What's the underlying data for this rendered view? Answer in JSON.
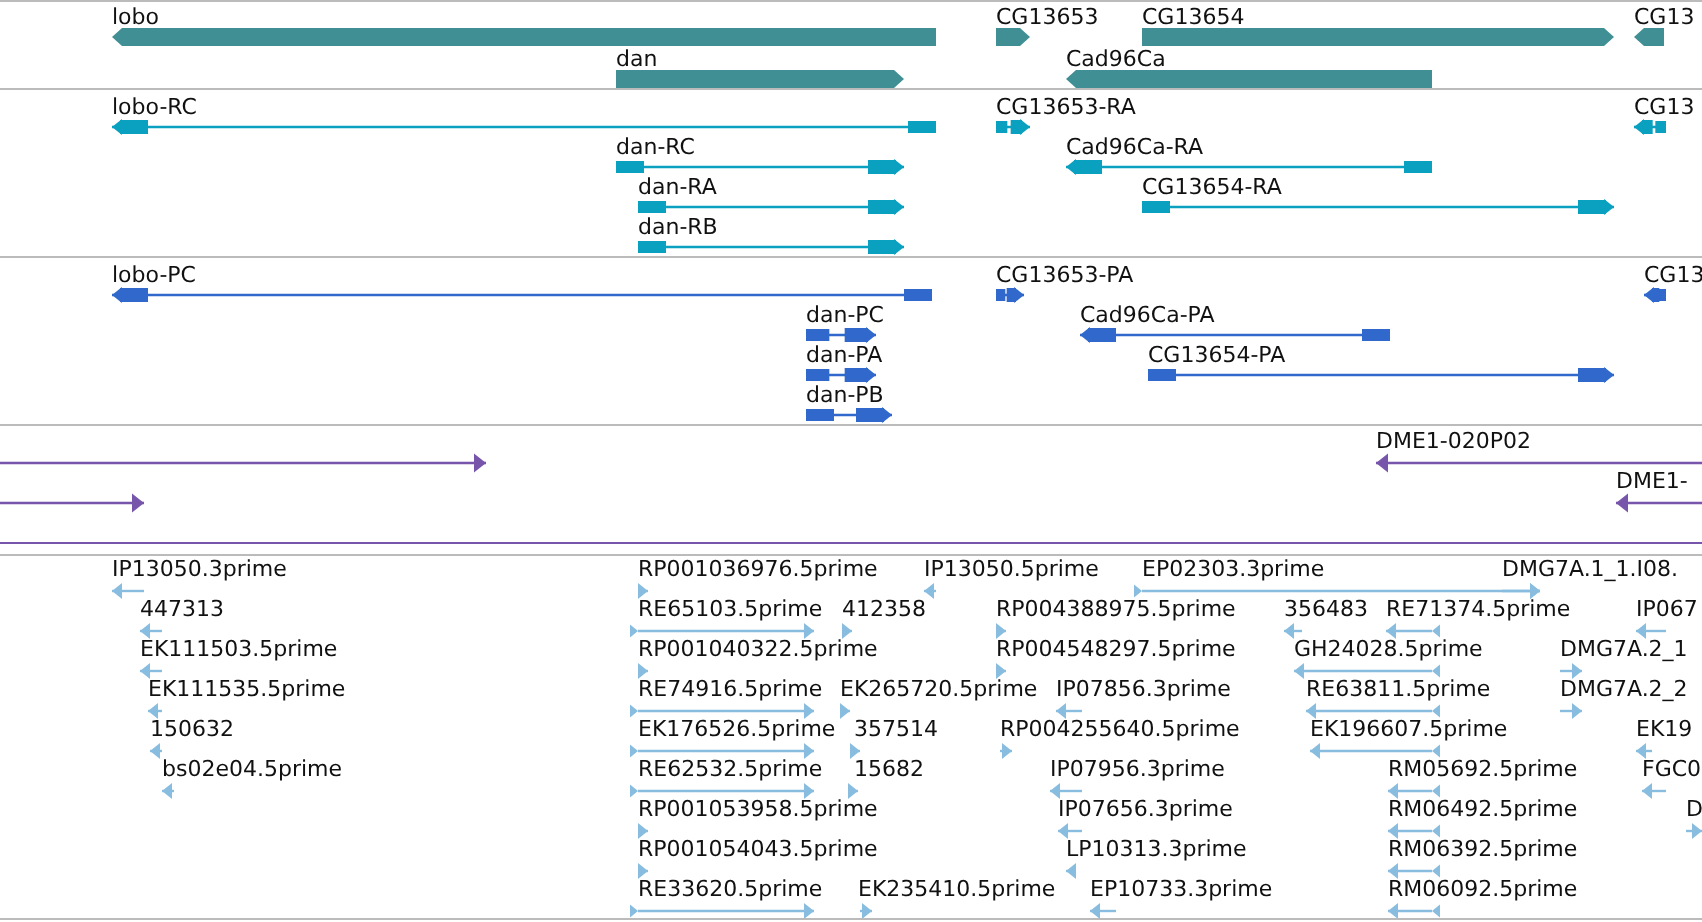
{
  "tracks": [
    {
      "kind": "gene",
      "color": "#3f8f94",
      "features": [
        {
          "label": "lobo",
          "reverse": true
        },
        {
          "label": "CG13653",
          "reverse": false
        },
        {
          "label": "CG13654",
          "reverse": false
        },
        {
          "label": "CG13",
          "reverse": true
        },
        {
          "label": "dan",
          "reverse": false
        },
        {
          "label": "Cad96Ca",
          "reverse": true
        }
      ]
    },
    {
      "kind": "transcript",
      "color": "#0aa0c0",
      "features": [
        {
          "label": "lobo-RC",
          "reverse": true
        },
        {
          "label": "CG13653-RA",
          "reverse": false
        },
        {
          "label": "CG13",
          "reverse": true
        },
        {
          "label": "dan-RC",
          "reverse": false
        },
        {
          "label": "Cad96Ca-RA",
          "reverse": true
        },
        {
          "label": "dan-RA",
          "reverse": false
        },
        {
          "label": "CG13654-RA",
          "reverse": false
        },
        {
          "label": "dan-RB",
          "reverse": false
        }
      ]
    },
    {
      "kind": "transcript",
      "color": "#3068cc",
      "features": [
        {
          "label": "lobo-PC",
          "reverse": true
        },
        {
          "label": "CG13653-PA",
          "reverse": false
        },
        {
          "label": "CG13",
          "reverse": true
        },
        {
          "label": "dan-PC",
          "reverse": false
        },
        {
          "label": "Cad96Ca-PA",
          "reverse": true
        },
        {
          "label": "dan-PA",
          "reverse": false
        },
        {
          "label": "CG13654-PA",
          "reverse": false
        },
        {
          "label": "dan-PB",
          "reverse": false
        }
      ]
    },
    {
      "kind": "clone",
      "color": "#7755aa",
      "features": [
        {
          "reverse": false
        },
        {
          "label": "DME1-020P02",
          "reverse": true
        },
        {
          "reverse": false
        },
        {
          "label": "DME1-",
          "reverse": true
        }
      ]
    },
    {
      "kind": "est",
      "color": "#88bde0",
      "features": [
        {
          "label": "IP13050.3prime",
          "reverse": true
        },
        {
          "label": "RP001036976.5prime",
          "reverse": false
        },
        {
          "label": "IP13050.5prime",
          "reverse": true
        },
        {
          "label": "EP02303.3prime",
          "reverse": false
        },
        {
          "label": "DMG7A.1_1.I08.",
          "reverse": false
        },
        {
          "label": "447313",
          "reverse": true
        },
        {
          "label": "RE65103.5prime",
          "reverse": false
        },
        {
          "label": "412358",
          "reverse": false
        },
        {
          "label": "RP004388975.5prime",
          "reverse": false
        },
        {
          "label": "356483",
          "reverse": true
        },
        {
          "label": "RE71374.5prime",
          "reverse": true
        },
        {
          "label": "IP067",
          "reverse": true
        },
        {
          "label": "EK111503.5prime",
          "reverse": true
        },
        {
          "label": "RP001040322.5prime",
          "reverse": false
        },
        {
          "label": "RP004548297.5prime",
          "reverse": false
        },
        {
          "label": "GH24028.5prime",
          "reverse": true
        },
        {
          "label": "DMG7A.2_1",
          "reverse": false
        },
        {
          "label": "EK111535.5prime",
          "reverse": true
        },
        {
          "label": "RE74916.5prime",
          "reverse": false
        },
        {
          "label": "EK265720.5prime",
          "reverse": false
        },
        {
          "label": "IP07856.3prime",
          "reverse": true
        },
        {
          "label": "RE63811.5prime",
          "reverse": true
        },
        {
          "label": "DMG7A.2_2",
          "reverse": false
        },
        {
          "label": "150632",
          "reverse": true
        },
        {
          "label": "EK176526.5prime",
          "reverse": false
        },
        {
          "label": "357514",
          "reverse": false
        },
        {
          "label": "RP004255640.5prime",
          "reverse": false
        },
        {
          "label": "EK196607.5prime",
          "reverse": true
        },
        {
          "label": "EK19",
          "reverse": true
        },
        {
          "label": "bs02e04.5prime",
          "reverse": true
        },
        {
          "label": "RE62532.5prime",
          "reverse": false
        },
        {
          "label": "15682",
          "reverse": false
        },
        {
          "label": "IP07956.3prime",
          "reverse": true
        },
        {
          "label": "RM05692.5prime",
          "reverse": true
        },
        {
          "label": "FGC0",
          "reverse": true
        },
        {
          "label": "RP001053958.5prime",
          "reverse": false
        },
        {
          "label": "IP07656.3prime",
          "reverse": true
        },
        {
          "label": "RM06492.5prime",
          "reverse": true
        },
        {
          "label": "D",
          "reverse": false
        },
        {
          "label": "RP001054043.5prime",
          "reverse": false
        },
        {
          "label": "LP10313.3prime",
          "reverse": true
        },
        {
          "label": "RM06392.5prime",
          "reverse": true
        },
        {
          "label": "RE33620.5prime",
          "reverse": false
        },
        {
          "label": "EK235410.5prime",
          "reverse": false
        },
        {
          "label": "EP10733.3prime",
          "reverse": true
        },
        {
          "label": "RM06092.5prime",
          "reverse": true
        }
      ]
    }
  ]
}
